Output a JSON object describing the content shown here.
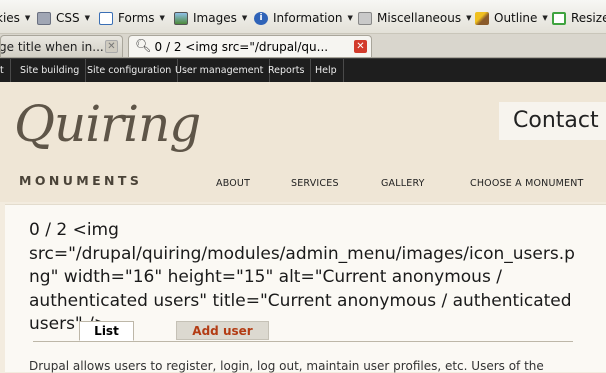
{
  "devbar": {
    "items": [
      {
        "label": "kies",
        "icon": "cookie-icon"
      },
      {
        "label": "CSS",
        "icon": "css-icon"
      },
      {
        "label": "Forms",
        "icon": "forms-icon"
      },
      {
        "label": "Images",
        "icon": "images-icon"
      },
      {
        "label": "Information",
        "icon": "information-icon"
      },
      {
        "label": "Miscellaneous",
        "icon": "miscellaneous-icon"
      },
      {
        "label": "Outline",
        "icon": "outline-icon"
      },
      {
        "label": "Resize",
        "icon": "resize-icon"
      }
    ]
  },
  "browser_tabs": {
    "inactive": {
      "title": "ge title when in..."
    },
    "active": {
      "title": "0 / 2 <img src=\"/drupal/qu..."
    }
  },
  "admin_menu": {
    "items": [
      "t",
      "Site building",
      "Site configuration",
      "User management",
      "Reports",
      "Help"
    ]
  },
  "site": {
    "logo_script": "Quiring",
    "logo_sub": "MONUMENTS",
    "contact": "Contact u",
    "nav": [
      "ABOUT",
      "SERVICES",
      "GALLERY",
      "CHOOSE A MONUMENT"
    ]
  },
  "page": {
    "title": "0 / 2 <img src=\"/drupal/quiring/modules/admin_menu/images/icon_users.png\" width=\"16\" height=\"15\" alt=\"Current anonymous / authenticated users\" title=\"Current anonymous / authenticated users\" />",
    "tabs": [
      "List",
      "Add user"
    ],
    "intro": "Drupal allows users to register, login, log out, maintain user profiles, etc. Users of the"
  },
  "colors": {
    "admin_bar": "#1e1e1e",
    "header_bg": "#efe6d6",
    "add_user_tab_text": "#b33c14",
    "active_tab_close": "#d23b2c"
  }
}
